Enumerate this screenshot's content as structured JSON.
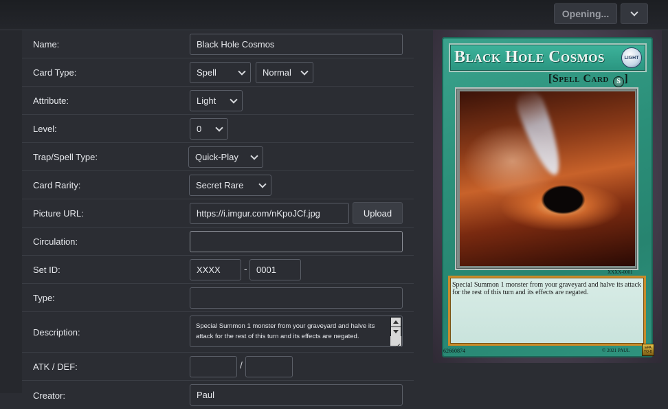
{
  "topbar": {
    "opening_label": "Opening...",
    "menu_icon": "chevron-down-icon"
  },
  "form": {
    "name": {
      "label": "Name:",
      "value": "Black Hole Cosmos"
    },
    "card_type": {
      "label": "Card Type:",
      "value": "Spell",
      "subtype": "Normal"
    },
    "attribute": {
      "label": "Attribute:",
      "value": "Light"
    },
    "level": {
      "label": "Level:",
      "value": "0"
    },
    "trap_spell_type": {
      "label": "Trap/Spell Type:",
      "value": "Quick-Play"
    },
    "rarity": {
      "label": "Card Rarity:",
      "value": "Secret Rare"
    },
    "picture_url": {
      "label": "Picture URL:",
      "value": "https://i.imgur.com/nKpoJCf.jpg",
      "upload_label": "Upload"
    },
    "circulation": {
      "label": "Circulation:",
      "value": ""
    },
    "set_id": {
      "label": "Set ID:",
      "prefix": "XXXX",
      "separator": "-",
      "number": "0001"
    },
    "type": {
      "label": "Type:",
      "value": ""
    },
    "description": {
      "label": "Description:",
      "value": "Special Summon 1 monster from your graveyard and halve its attack for the rest of this turn and its effects are negated."
    },
    "atk_def": {
      "label": "ATK / DEF:",
      "atk": "",
      "separator": "/",
      "def": ""
    },
    "creator": {
      "label": "Creator:",
      "value": "Paul"
    }
  },
  "card": {
    "title": "Black Hole Cosmos",
    "attribute_text": "LIGHT",
    "type_line": "[Spell Card",
    "type_line_end": "]",
    "spell_symbol": "S",
    "set_code": "XXXX-0001",
    "description": "Special Summon 1 monster from your graveyard and halve its attack for the rest of this turn and its effects are negated.",
    "passcode": "62660874",
    "copyright": "© 2021 PAUL",
    "corner_logo": "EPA YO-D"
  },
  "colors": {
    "background": "#2b2d33",
    "card_green": "#2b8f79",
    "desc_border": "#c98b2a"
  }
}
